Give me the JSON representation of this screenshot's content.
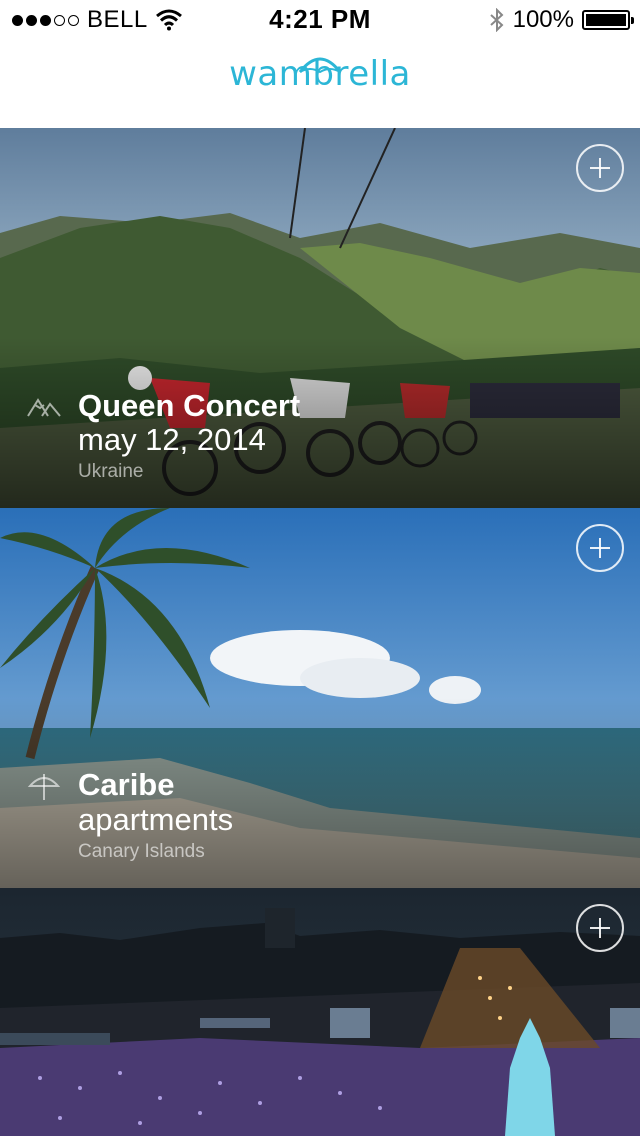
{
  "status_bar": {
    "carrier": "BELL",
    "signal_bars": 3,
    "signal_total": 5,
    "time": "4:21 PM",
    "battery_pct": "100%",
    "icons": [
      "wifi-icon",
      "bluetooth-icon",
      "battery-icon"
    ]
  },
  "header": {
    "logo_text": "wambrella",
    "logo_color": "#2cb6d6"
  },
  "cards": [
    {
      "title": "Queen Concert",
      "subtitle": "may 12, 2014",
      "location": "Ukraine",
      "category_icon": "mountains-icon",
      "action_icon": "add-icon"
    },
    {
      "title": "Caribe",
      "subtitle": "apartments",
      "location": "Canary Islands",
      "category_icon": "umbrella-icon",
      "action_icon": "add-icon"
    },
    {
      "title": "",
      "subtitle": "",
      "location": "",
      "category_icon": "",
      "action_icon": "add-icon"
    }
  ]
}
